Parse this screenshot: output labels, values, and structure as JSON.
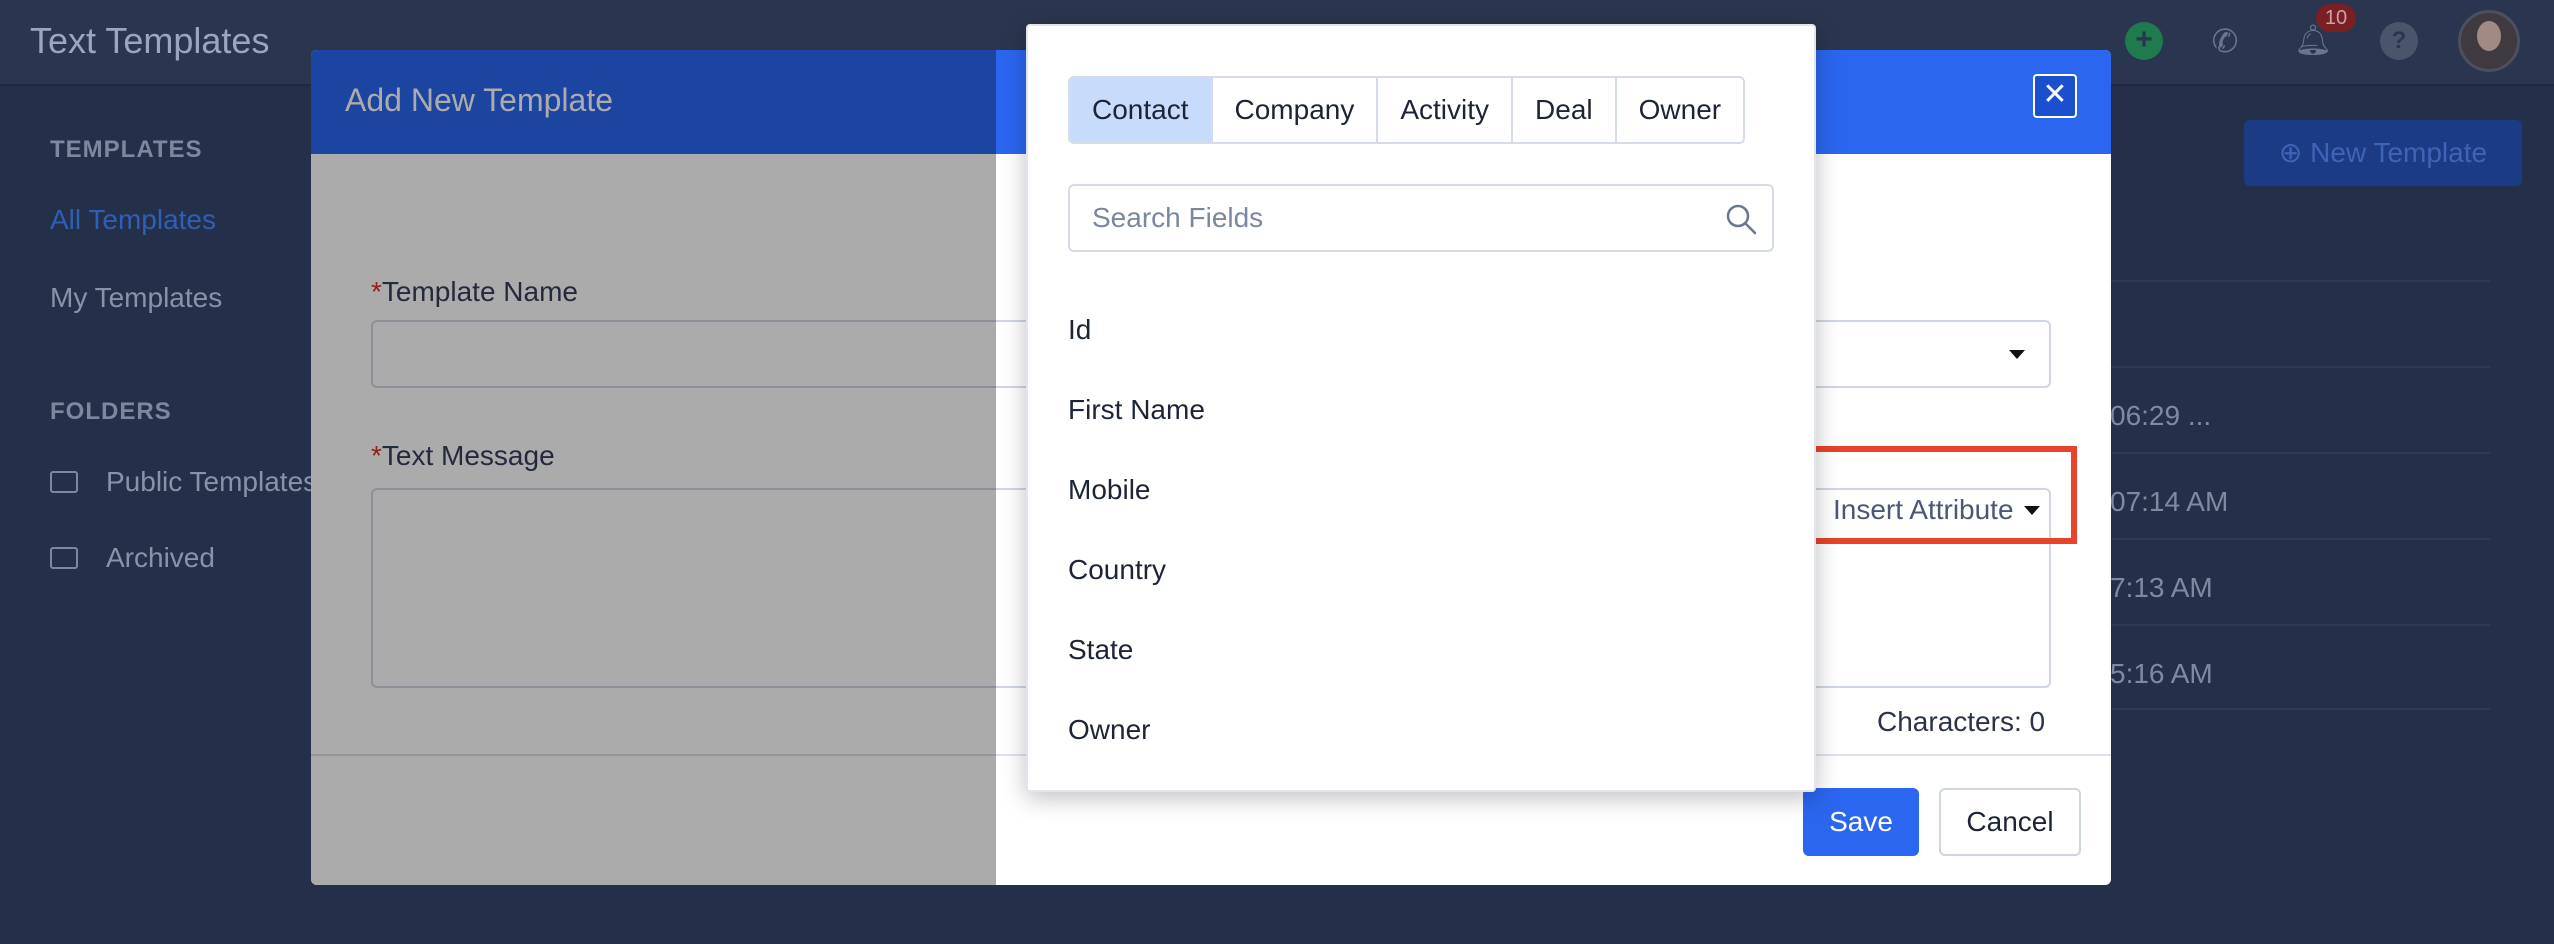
{
  "app": {
    "title": "Text Templates",
    "notification_count": "10"
  },
  "sidebar": {
    "templates_heading": "TEMPLATES",
    "links": [
      {
        "label": "All Templates",
        "active": true
      },
      {
        "label": "My Templates",
        "active": false
      }
    ],
    "folders_heading": "FOLDERS",
    "folders": [
      {
        "label": "Public Templates",
        "icon": "folder-icon"
      },
      {
        "label": "Archived",
        "icon": "archive-icon"
      }
    ]
  },
  "background": {
    "new_template_label": "New Template",
    "rows": [
      "06:29 ...",
      "07:14 AM",
      "7:13 AM",
      "5:16 AM"
    ]
  },
  "modal": {
    "title": "Add New Template",
    "template_name_label": "Template Name",
    "text_message_label": "Text Message",
    "required_marker": "*",
    "insert_attribute_label": "Insert Attribute",
    "characters_label": "Characters: 0",
    "save_label": "Save",
    "cancel_label": "Cancel"
  },
  "attribute_panel": {
    "tabs": [
      "Contact",
      "Company",
      "Activity",
      "Deal",
      "Owner"
    ],
    "active_tab": "Contact",
    "search_placeholder": "Search Fields",
    "fields": [
      "Id",
      "First Name",
      "Mobile",
      "Country",
      "State",
      "Owner"
    ]
  },
  "colors": {
    "primary": "#2b66f0",
    "highlight": "#e8432b",
    "active_tab": "#c7dbfa"
  }
}
